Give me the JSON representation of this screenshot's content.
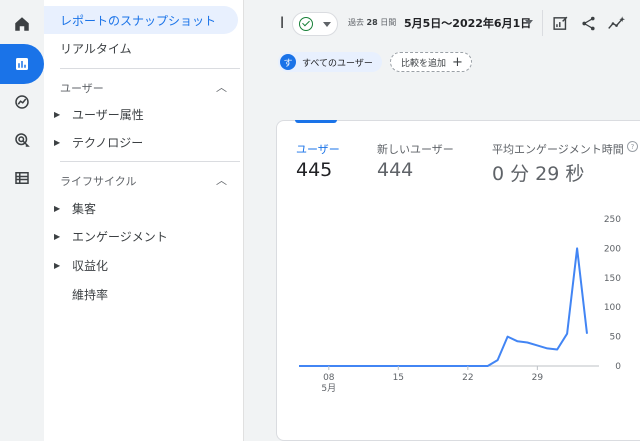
{
  "nav": {
    "report_snapshot": "レポートのスナップショット",
    "realtime": "リアルタイム",
    "sections": [
      {
        "title": "ユーザー",
        "items": [
          "ユーザー属性",
          "テクノロジー"
        ]
      },
      {
        "title": "ライフサイクル",
        "items": [
          "集客",
          "エンゲージメント",
          "収益化",
          "維持率"
        ]
      }
    ]
  },
  "rail": {
    "icons": [
      "home-icon",
      "reports-icon",
      "explore-icon",
      "advertising-icon",
      "configure-icon"
    ]
  },
  "header": {
    "title_stub": "l",
    "period_prefix": "過去",
    "period_days": "28",
    "period_suffix": "日間",
    "date_range": "5月5日～2022年6月1日",
    "tools": [
      "customize-report-icon",
      "share-icon",
      "insights-icon"
    ]
  },
  "segments": {
    "avatar_letter": "す",
    "all_users": "すべてのユーザー",
    "add_comparison": "比較を追加",
    "plus": "+"
  },
  "metrics": [
    {
      "label": "ユーザー",
      "value": "445",
      "active": true
    },
    {
      "label": "新しいユーザー",
      "value": "444",
      "active": false
    },
    {
      "label": "平均エンゲージメント時間",
      "value": "0 分 29 秒",
      "active": false
    }
  ],
  "help": "?",
  "colors": {
    "accent": "#1a73e8",
    "line": "#4285f4",
    "success": "#188038"
  },
  "chart_data": {
    "type": "line",
    "series": [
      {
        "values": [
          0,
          0,
          0,
          0,
          0,
          0,
          0,
          0,
          0,
          0,
          0,
          0,
          0,
          0,
          0,
          0,
          0,
          0,
          0,
          0,
          10,
          50,
          42,
          40,
          35,
          30,
          28,
          55,
          200,
          55
        ]
      }
    ],
    "x": [
      "05-05",
      "05-06",
      "05-07",
      "05-08",
      "05-09",
      "05-10",
      "05-11",
      "05-12",
      "05-13",
      "05-14",
      "05-15",
      "05-16",
      "05-17",
      "05-18",
      "05-19",
      "05-20",
      "05-21",
      "05-22",
      "05-23",
      "05-24",
      "05-25",
      "05-26",
      "05-27",
      "05-28",
      "05-29",
      "05-30",
      "05-31",
      "06-01",
      "06-02",
      "06-03"
    ],
    "xticks": [
      {
        "index": 3,
        "label": "08",
        "sub": "5月"
      },
      {
        "index": 10,
        "label": "15",
        "sub": ""
      },
      {
        "index": 17,
        "label": "22",
        "sub": ""
      },
      {
        "index": 24,
        "label": "29",
        "sub": ""
      }
    ],
    "yticks": [
      "0",
      "50",
      "100",
      "150",
      "200",
      "250"
    ],
    "ylim": [
      0,
      250
    ],
    "grid": false
  }
}
